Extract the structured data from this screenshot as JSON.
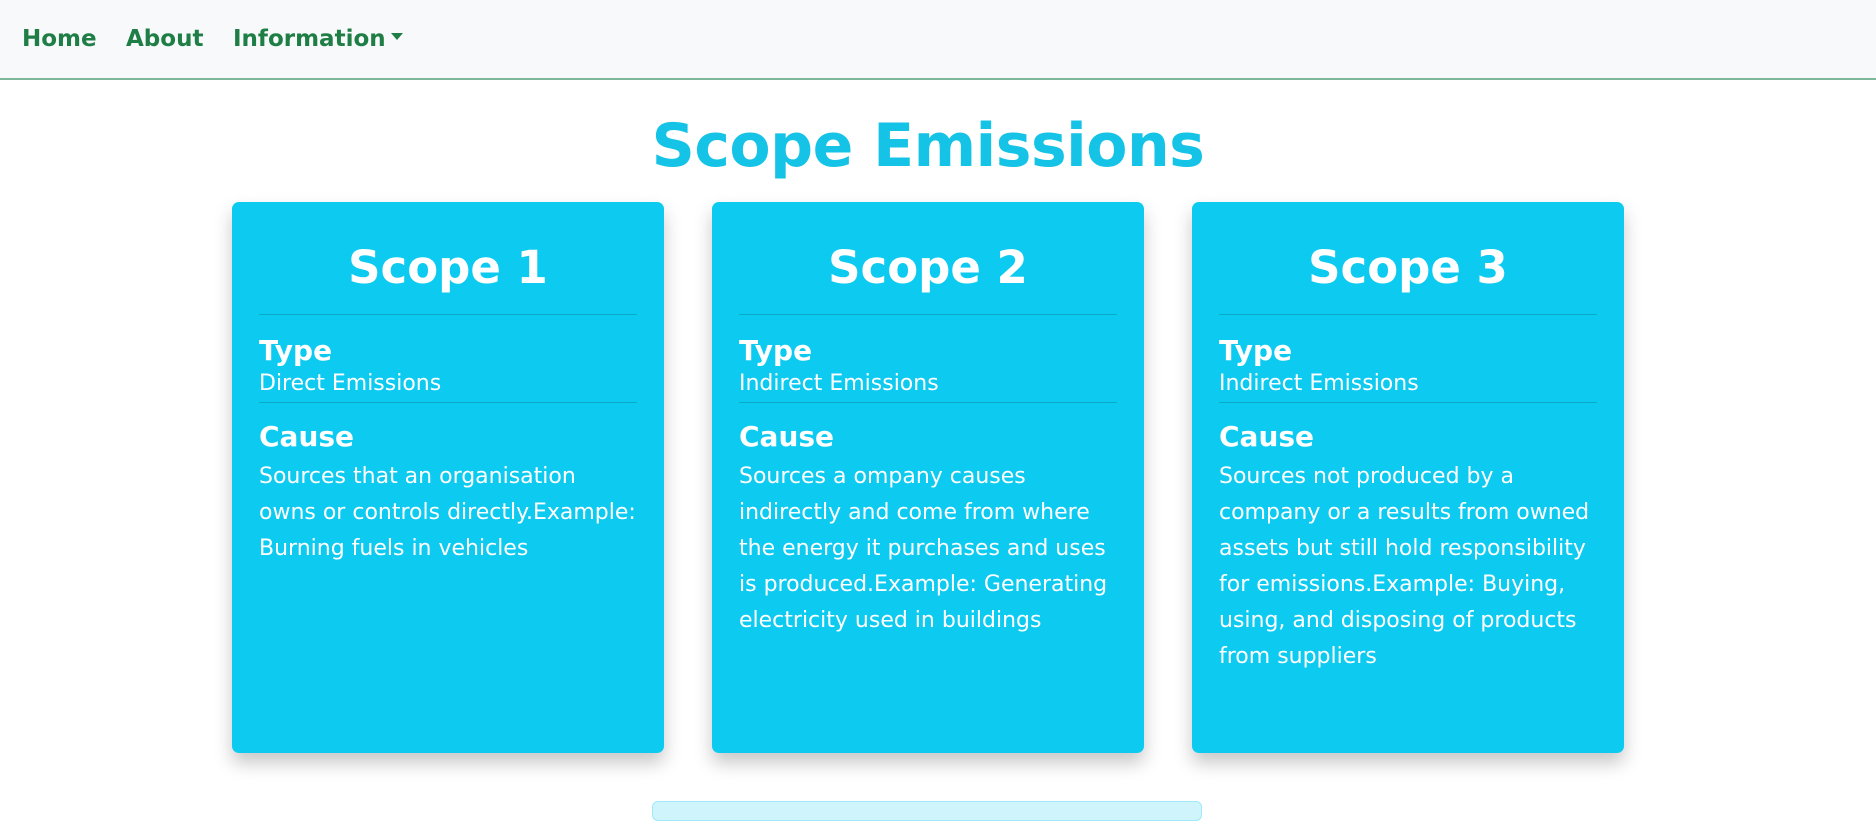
{
  "nav": {
    "home": "Home",
    "about": "About",
    "information": "Information"
  },
  "page": {
    "title": "Scope Emissions"
  },
  "labels": {
    "type": "Type",
    "cause": "Cause"
  },
  "cards": [
    {
      "title": "Scope 1",
      "type": "Direct Emissions",
      "cause": "Sources that an organisation owns or controls directly.Example: Burning fuels in vehicles"
    },
    {
      "title": "Scope 2",
      "type": "Indirect Emissions",
      "cause": "Sources a ompany causes indirectly and come from where the energy it purchases and uses is produced.Example: Generating electricity used in buildings"
    },
    {
      "title": "Scope 3",
      "type": "Indirect Emissions",
      "cause": "Sources not produced by a company or a results from owned assets but still hold responsibility for emissions.Example: Buying, using, and disposing of products from suppliers"
    }
  ],
  "colors": {
    "nav_link": "#1e7e45",
    "title": "#14c3e6",
    "card_bg": "#0dcaf0",
    "alert_bg": "#cff4fc"
  },
  "icons": {
    "dropdown": "caret-down-icon"
  }
}
